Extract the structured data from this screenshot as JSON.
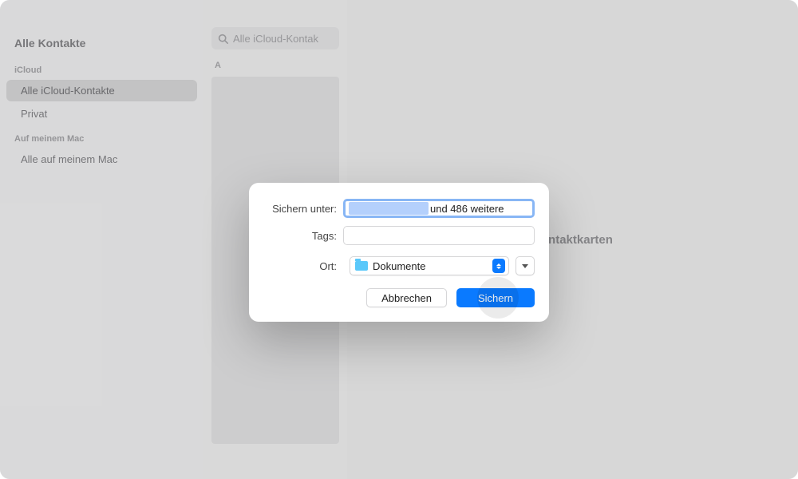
{
  "traffic": {
    "red": "#fe5f57",
    "yellow": "#febc2e",
    "green": "#28c840"
  },
  "sidebar": {
    "title": "Alle Kontakte",
    "groups": [
      {
        "label": "iCloud",
        "items": [
          {
            "label": "Alle iCloud-Kontakte",
            "selected": true
          },
          {
            "label": "Privat"
          }
        ]
      },
      {
        "label": "Auf meinem Mac",
        "items": [
          {
            "label": "Alle auf meinem Mac"
          }
        ]
      }
    ]
  },
  "midcol": {
    "search_placeholder": "Alle iCloud-Kontak",
    "section_letter": "A"
  },
  "detail": {
    "summary": "Kontaktkarten"
  },
  "sheet": {
    "save_as_label": "Sichern unter:",
    "save_as_suffix": "und 486 weitere",
    "tags_label": "Tags:",
    "location_label": "Ort:",
    "location_value": "Dokumente",
    "cancel": "Abbrechen",
    "save": "Sichern"
  }
}
